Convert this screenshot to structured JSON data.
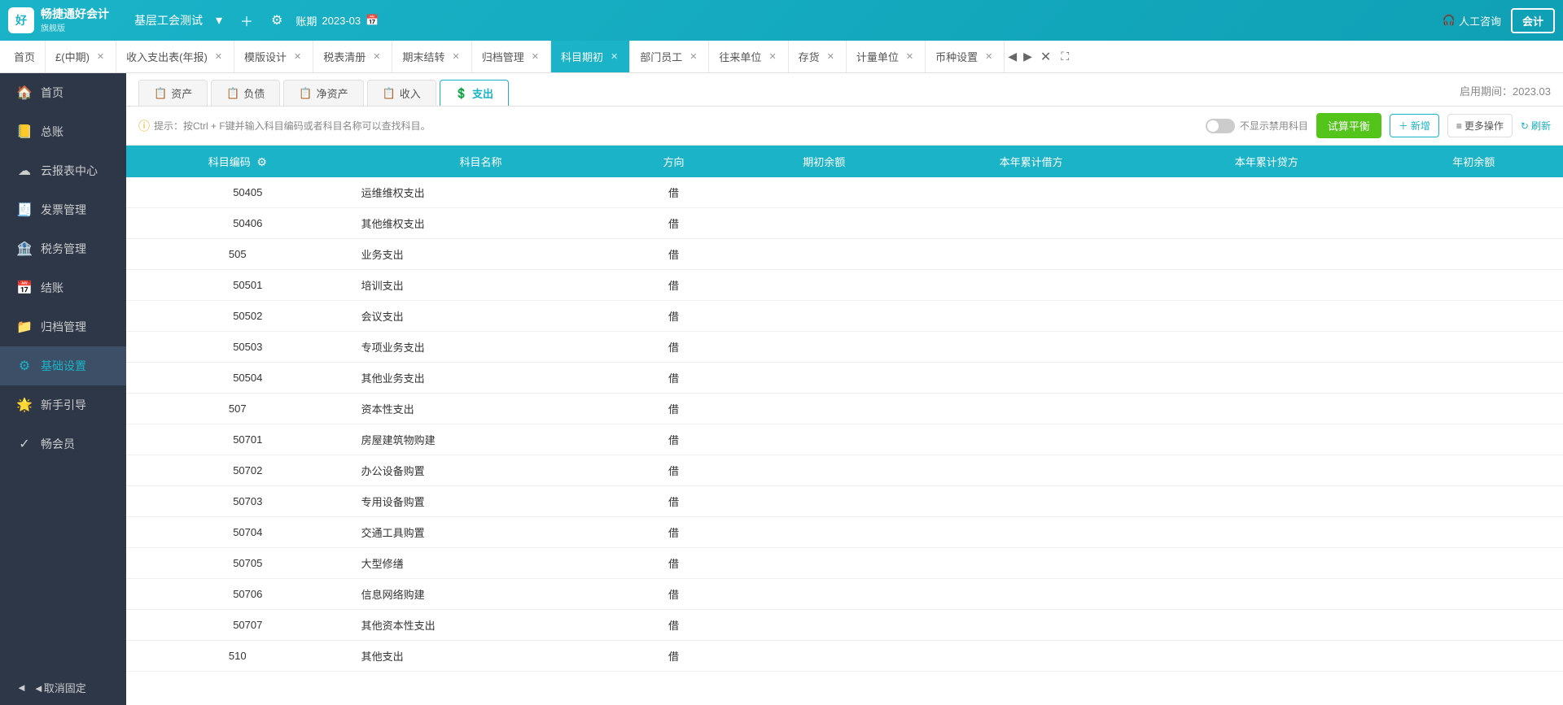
{
  "app": {
    "logo_text": "畅捷通好会计",
    "logo_sub": "旗舰版",
    "company_name": "基层工会测试",
    "period_label": "账期",
    "period_value": "2023-03",
    "service_btn": "人工咨询",
    "kuaiji_btn": "会计"
  },
  "tabs": [
    {
      "id": "home",
      "label": "首页",
      "closable": false
    },
    {
      "id": "period",
      "label": "£(中期)",
      "closable": true
    },
    {
      "id": "income",
      "label": "收入支出表(年报)",
      "closable": true
    },
    {
      "id": "template",
      "label": "模版设计",
      "closable": true
    },
    {
      "id": "tax",
      "label": "税表清册",
      "closable": true
    },
    {
      "id": "period_end",
      "label": "期末结转",
      "closable": true
    },
    {
      "id": "archive",
      "label": "归档管理",
      "closable": true
    },
    {
      "id": "subject_init",
      "label": "科目期初",
      "closable": true,
      "active": true
    },
    {
      "id": "department",
      "label": "部门员工",
      "closable": true
    },
    {
      "id": "unit",
      "label": "往来单位",
      "closable": true
    },
    {
      "id": "inventory",
      "label": "存货",
      "closable": true
    },
    {
      "id": "measure",
      "label": "计量单位",
      "closable": true
    },
    {
      "id": "currency",
      "label": "币种设置",
      "closable": true
    }
  ],
  "sidebar": {
    "items": [
      {
        "id": "home",
        "icon": "🏠",
        "label": "首页"
      },
      {
        "id": "ledger",
        "icon": "📒",
        "label": "总账"
      },
      {
        "id": "report",
        "icon": "☁",
        "label": "云报表中心"
      },
      {
        "id": "invoice",
        "icon": "🧾",
        "label": "发票管理"
      },
      {
        "id": "tax",
        "icon": "🏦",
        "label": "税务管理"
      },
      {
        "id": "close",
        "icon": "📅",
        "label": "结账"
      },
      {
        "id": "archive",
        "icon": "📁",
        "label": "归档管理"
      },
      {
        "id": "settings",
        "icon": "⚙",
        "label": "基础设置",
        "active": true
      },
      {
        "id": "guide",
        "icon": "🌟",
        "label": "新手引导"
      },
      {
        "id": "member",
        "icon": "✓",
        "label": "畅会员"
      }
    ],
    "bottom_label": "◄取消固定"
  },
  "sub_tabs": [
    {
      "id": "asset",
      "icon": "📋",
      "label": "资产"
    },
    {
      "id": "liability",
      "icon": "📋",
      "label": "负债"
    },
    {
      "id": "net_asset",
      "icon": "📋",
      "label": "净资产"
    },
    {
      "id": "income",
      "icon": "📋",
      "label": "收入"
    },
    {
      "id": "expense",
      "icon": "📋",
      "label": "支出",
      "active": true
    }
  ],
  "period_info": "启用期间：2023.03",
  "hint": "提示：按Ctrl + F键并输入科目编码或者科目名称可以查找科目。",
  "toolbar": {
    "calculate_btn": "试算平衡",
    "add_btn": "+ 新增",
    "more_btn": "更多操作",
    "refresh_btn": "刷新",
    "toggle_label": "不显示禁用科目"
  },
  "table": {
    "columns": [
      "科目编码",
      "科目名称",
      "方向",
      "期初余额",
      "本年累计借方",
      "本年累计贷方",
      "年初余额"
    ],
    "rows": [
      {
        "code": "50405",
        "name": "运维维权支出",
        "direction": "借",
        "parent": false
      },
      {
        "code": "50406",
        "name": "其他维权支出",
        "direction": "借",
        "parent": false
      },
      {
        "code": "505",
        "name": "业务支出",
        "direction": "借",
        "parent": true
      },
      {
        "code": "50501",
        "name": "培训支出",
        "direction": "借",
        "parent": false
      },
      {
        "code": "50502",
        "name": "会议支出",
        "direction": "借",
        "parent": false
      },
      {
        "code": "50503",
        "name": "专项业务支出",
        "direction": "借",
        "parent": false
      },
      {
        "code": "50504",
        "name": "其他业务支出",
        "direction": "借",
        "parent": false
      },
      {
        "code": "507",
        "name": "资本性支出",
        "direction": "借",
        "parent": true
      },
      {
        "code": "50701",
        "name": "房屋建筑物购建",
        "direction": "借",
        "parent": false
      },
      {
        "code": "50702",
        "name": "办公设备购置",
        "direction": "借",
        "parent": false
      },
      {
        "code": "50703",
        "name": "专用设备购置",
        "direction": "借",
        "parent": false
      },
      {
        "code": "50704",
        "name": "交通工具购置",
        "direction": "借",
        "parent": false
      },
      {
        "code": "50705",
        "name": "大型修缮",
        "direction": "借",
        "parent": false
      },
      {
        "code": "50706",
        "name": "信息网络购建",
        "direction": "借",
        "parent": false
      },
      {
        "code": "50707",
        "name": "其他资本性支出",
        "direction": "借",
        "parent": false
      },
      {
        "code": "510",
        "name": "其他支出",
        "direction": "借",
        "parent": true
      }
    ]
  }
}
